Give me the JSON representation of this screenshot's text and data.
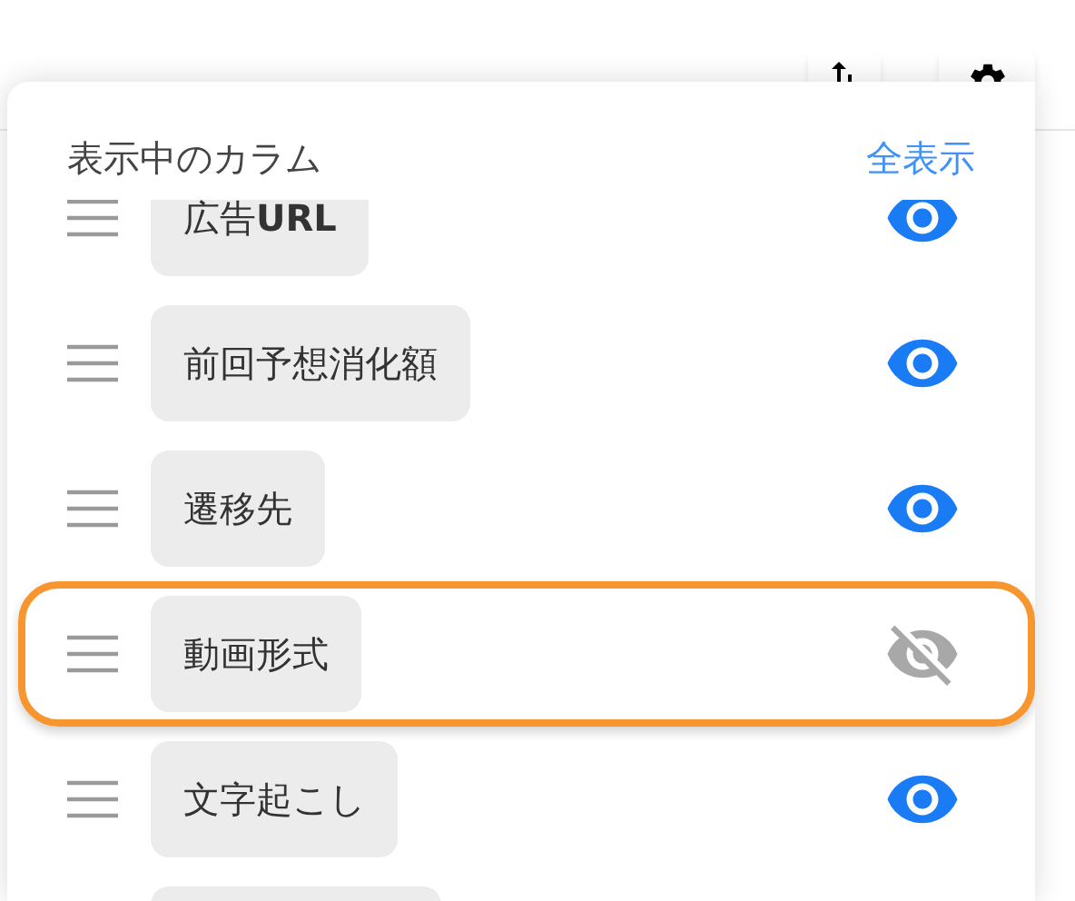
{
  "panel": {
    "title": "表示中のカラム",
    "show_all_link": "全表示"
  },
  "columns": [
    {
      "label": "広告**URL**",
      "visible": true,
      "highlighted": false
    },
    {
      "label": "前回予想消化額",
      "visible": true,
      "highlighted": false
    },
    {
      "label": "遷移先",
      "visible": true,
      "highlighted": false
    },
    {
      "label": "動画形式",
      "visible": false,
      "highlighted": true
    },
    {
      "label": "文字起こし",
      "visible": true,
      "highlighted": false
    }
  ]
}
